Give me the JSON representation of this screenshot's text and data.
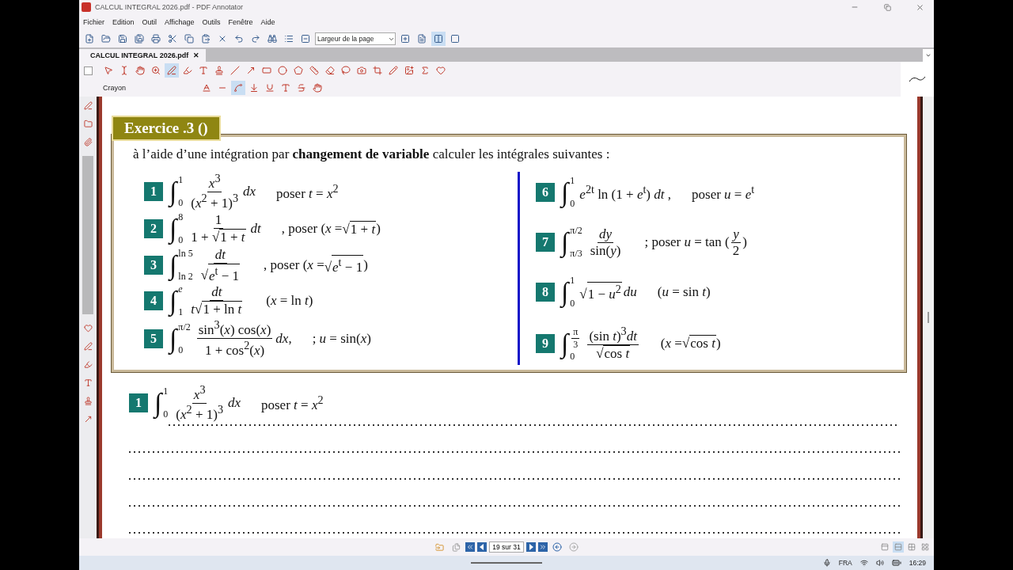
{
  "window": {
    "title": "CALCUL INTEGRAL 2026.pdf - PDF Annotator"
  },
  "menu": [
    "Fichier",
    "Edition",
    "Outil",
    "Affichage",
    "Outils",
    "Fenêtre",
    "Aide"
  ],
  "toolbar": [
    {
      "kind": "new"
    },
    {
      "kind": "open"
    },
    {
      "kind": "save"
    },
    {
      "kind": "save-as"
    },
    {
      "kind": "print"
    },
    {
      "kind": "cut"
    },
    {
      "kind": "copy"
    },
    {
      "kind": "paste"
    },
    {
      "kind": "delete"
    },
    {
      "kind": "undo"
    },
    {
      "kind": "redo"
    },
    {
      "kind": "find"
    },
    {
      "kind": "list"
    },
    {
      "kind": "zoom-out"
    }
  ],
  "zoom": {
    "value": "Largeur de la page"
  },
  "view_buttons": [
    {
      "kind": "zoom-in",
      "selected": false
    },
    {
      "kind": "page",
      "selected": false
    },
    {
      "kind": "width",
      "selected": true
    },
    {
      "kind": "full",
      "selected": false
    }
  ],
  "tab": {
    "label": "CALCUL INTEGRAL 2026.pdf",
    "close": "✕"
  },
  "annotation_tools": [
    {
      "kind": "pointer",
      "selected": false
    },
    {
      "kind": "text-select",
      "selected": false
    },
    {
      "kind": "hand",
      "selected": false
    },
    {
      "kind": "zoom",
      "selected": false
    },
    {
      "kind": "pen",
      "selected": true
    },
    {
      "kind": "highlighter",
      "selected": false
    },
    {
      "kind": "textbox",
      "selected": false
    },
    {
      "kind": "stamp",
      "selected": false
    },
    {
      "kind": "line",
      "selected": false
    },
    {
      "kind": "arrow",
      "selected": false
    },
    {
      "kind": "rectangle",
      "selected": false
    },
    {
      "kind": "ellipse",
      "selected": false
    },
    {
      "kind": "polygon",
      "selected": false
    },
    {
      "kind": "measure",
      "selected": false
    },
    {
      "kind": "eraser",
      "selected": false
    },
    {
      "kind": "lasso",
      "selected": false
    },
    {
      "kind": "camera",
      "selected": false
    },
    {
      "kind": "crop",
      "selected": false
    },
    {
      "kind": "pencil",
      "selected": false
    },
    {
      "kind": "image",
      "selected": false
    },
    {
      "kind": "sigma",
      "selected": false
    },
    {
      "kind": "favorite",
      "selected": false
    }
  ],
  "tool_label": "Crayon",
  "panel_toggle": {
    "checked": false
  },
  "properties": [
    {
      "kind": "color",
      "selected": false
    },
    {
      "kind": "line-style",
      "selected": false
    },
    {
      "kind": "curve",
      "selected": true
    },
    {
      "kind": "smooth",
      "selected": false
    },
    {
      "kind": "underline",
      "selected": false
    },
    {
      "kind": "squiggle",
      "selected": false
    },
    {
      "kind": "strike",
      "selected": false
    },
    {
      "kind": "hand",
      "selected": false
    }
  ],
  "sidebar": [
    {
      "kind": "pen"
    },
    {
      "kind": "folder"
    },
    {
      "kind": "clip"
    },
    {
      "kind": "heart"
    },
    {
      "kind": "pen"
    },
    {
      "kind": "highlighter"
    },
    {
      "kind": "textbox"
    },
    {
      "kind": "stamp"
    },
    {
      "kind": "arrow"
    }
  ],
  "exercise": {
    "title": "Exercice .3 ()",
    "intro": "à l’aide d’une intégration par **changement de variable** calculer les intégrales suivantes :",
    "columns": [
      [
        {
          "number": "1",
          "sign": "∫",
          "upper": [
            "1"
          ],
          "lower": [
            "0"
          ],
          "body": [
            {
              "num": [
                "*x*$^{3}$"
              ],
              "den": [
                "(*x*$^{2}$ + 1)$^{3}$"
              ]
            },
            "*dx*"
          ],
          "hint": [
            "poser *t* = *x*$^{2}$"
          ]
        },
        {
          "number": "2",
          "sign": "∫",
          "upper": [
            "8"
          ],
          "lower": [
            "0"
          ],
          "body": [
            {
              "num": [
                "1"
              ],
              "den": [
                "1 + ",
                {
                  "radical": "√",
                  "radicand": "1 + *t*"
                }
              ]
            },
            "*dt*"
          ],
          "hint": [
            ", poser (*x* = ",
            {
              "radical": "√",
              "radicand": "1 + *t*"
            },
            ")"
          ]
        },
        {
          "number": "3",
          "sign": "∫",
          "upper": [
            "ln 5"
          ],
          "lower": [
            "ln 2"
          ],
          "body": [
            {
              "num": [
                "*dt*"
              ],
              "den": [
                {
                  "radical": "√",
                  "radicand": "*e*$^{t}$ − 1"
                }
              ]
            }
          ],
          "hint": [
            ", poser (*x* = ",
            {
              "radical": "√",
              "radicand": "*e*$^{t}$ − 1"
            },
            ")"
          ]
        },
        {
          "number": "4",
          "sign": "∫",
          "upper": [
            "*e*"
          ],
          "lower": [
            "1"
          ],
          "body": [
            {
              "num": [
                "*dt*"
              ],
              "den": [
                "*t*",
                {
                  "radical": "√",
                  "radicand": "1 + ln *t*"
                }
              ]
            }
          ],
          "hint": [
            "(*x* = ln *t*)"
          ]
        },
        {
          "number": "5",
          "sign": "∫",
          "upper": [
            "π/2"
          ],
          "lower": [
            "0"
          ],
          "body": [
            {
              "num": [
                "sin$^{3}$(*x*) cos(*x*)"
              ],
              "den": [
                "1 + cos$^{2}$(*x*)"
              ]
            },
            "*dx*,"
          ],
          "hint": [
            "; *u* = sin(*x*)"
          ]
        }
      ],
      [
        {
          "number": "6",
          "sign": "∫",
          "upper": [
            "1"
          ],
          "lower": [
            "0"
          ],
          "body": [
            "*e*$^{2t}$ ln (1 + *e*$^{t}$) *dt* ,"
          ],
          "hint": [
            "poser *u* = *e*$^{t}$"
          ]
        },
        {
          "number": "7",
          "sign": "∫",
          "upper": [
            "π/2"
          ],
          "lower": [
            "π/3"
          ],
          "body": [
            {
              "num": [
                "*dy*"
              ],
              "den": [
                "sin(*y*)"
              ]
            }
          ],
          "hint": [
            "; poser *u* = tan (",
            {
              "num": [
                "*y*"
              ],
              "den": [
                "2"
              ]
            },
            ")"
          ]
        },
        {
          "number": "8",
          "sign": "∫",
          "upper": [
            "1"
          ],
          "lower": [
            "0"
          ],
          "body": [
            {
              "radical": "√",
              "radicand": "1 − *u*$^{2}$"
            },
            "*du*"
          ],
          "hint": [
            "(*u* = sin *t*)"
          ]
        },
        {
          "number": "9",
          "sign": "∫",
          "upper": [
            {
              "num": [
                "π"
              ],
              "den": [
                "3"
              ]
            }
          ],
          "lower": [
            "0"
          ],
          "body": [
            {
              "num": [
                "(sin *t*)$^{3}$*dt*"
              ],
              "den": [
                {
                  "radical": "√",
                  "radicand": "cos *t*"
                }
              ]
            }
          ],
          "hint": [
            "(*x* = ",
            {
              "radical": "√",
              "radicand": "cos *t*"
            },
            ")"
          ]
        }
      ]
    ]
  },
  "answer": {
    "number": "1",
    "sign": "∫",
    "upper": [
      "1"
    ],
    "lower": [
      "0"
    ],
    "body": [
      {
        "num": [
          "*x*$^{3}$"
        ],
        "den": [
          "(*x*$^{2}$ + 1)$^{3}$"
        ]
      },
      "*dx*"
    ],
    "hint": [
      "poser *t* = *x*$^{2}$"
    ]
  },
  "status_bar": {
    "page": "19 sur 31",
    "modes": [
      {
        "selected": false
      },
      {
        "selected": true
      },
      {
        "selected": false
      },
      {
        "selected": false
      }
    ]
  },
  "taskbar": {
    "language": "FRA",
    "time": "16:29"
  }
}
